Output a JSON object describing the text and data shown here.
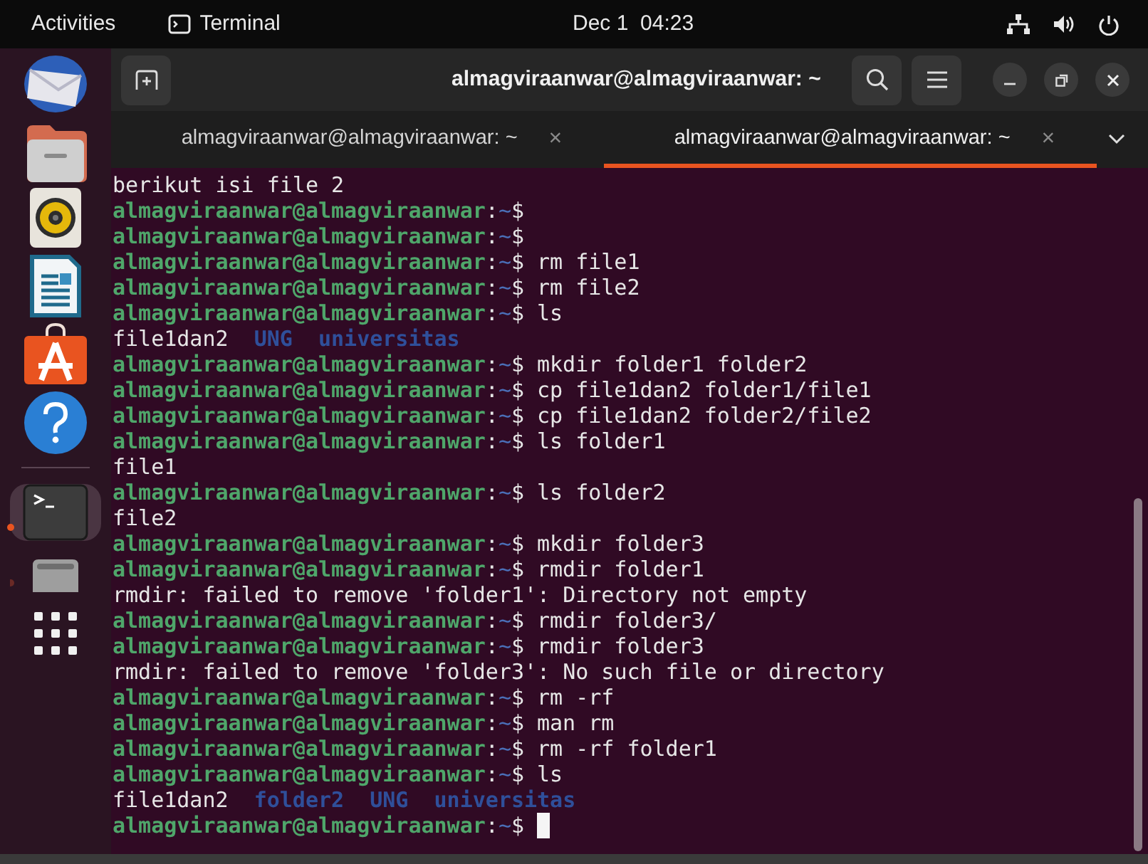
{
  "top_bar": {
    "activities": "Activities",
    "app_name": "Terminal",
    "clock": "Dec 1  04:23"
  },
  "dock": {
    "items": [
      {
        "kind": "mail",
        "running": false,
        "selected": false
      },
      {
        "kind": "files",
        "running": false,
        "selected": false
      },
      {
        "kind": "music",
        "running": false,
        "selected": false
      },
      {
        "kind": "writer",
        "running": false,
        "selected": false
      },
      {
        "kind": "store",
        "running": false,
        "selected": false
      },
      {
        "kind": "help",
        "running": false,
        "selected": false
      },
      {
        "kind": "terminal",
        "running": true,
        "selected": true
      },
      {
        "kind": "drive",
        "running": true,
        "selected": false
      }
    ]
  },
  "window": {
    "title": "almagviraanwar@almagviraanwar: ~"
  },
  "tabs": [
    {
      "label": "almagviraanwar@almagviraanwar: ~",
      "close": "×",
      "selected": false
    },
    {
      "label": "almagviraanwar@almagviraanwar: ~",
      "close": "×",
      "selected": true
    }
  ],
  "terminal": {
    "lines": [
      {
        "kind": "output",
        "text": "berikut isi file 2"
      },
      {
        "kind": "prompt",
        "user": "almagviraanwar@almagviraanwar",
        "colon": ":",
        "path": "~",
        "symbol": "$"
      },
      {
        "kind": "prompt",
        "user": "almagviraanwar@almagviraanwar",
        "colon": ":",
        "path": "~",
        "symbol": "$"
      },
      {
        "kind": "prompt",
        "user": "almagviraanwar@almagviraanwar",
        "colon": ":",
        "path": "~",
        "symbol": "$",
        "command": "rm file1"
      },
      {
        "kind": "prompt",
        "user": "almagviraanwar@almagviraanwar",
        "colon": ":",
        "path": "~",
        "symbol": "$",
        "command": "rm file2"
      },
      {
        "kind": "prompt",
        "user": "almagviraanwar@almagviraanwar",
        "colon": ":",
        "path": "~",
        "symbol": "$",
        "command": "ls"
      },
      {
        "kind": "listing",
        "entries": [
          {
            "text": "file1dan2",
            "kind": "file"
          },
          {
            "text": "UNG",
            "kind": "dir"
          },
          {
            "text": "universitas",
            "kind": "dir"
          }
        ]
      },
      {
        "kind": "prompt",
        "user": "almagviraanwar@almagviraanwar",
        "colon": ":",
        "path": "~",
        "symbol": "$",
        "command": "mkdir folder1 folder2"
      },
      {
        "kind": "prompt",
        "user": "almagviraanwar@almagviraanwar",
        "colon": ":",
        "path": "~",
        "symbol": "$",
        "command": "cp file1dan2 folder1/file1"
      },
      {
        "kind": "prompt",
        "user": "almagviraanwar@almagviraanwar",
        "colon": ":",
        "path": "~",
        "symbol": "$",
        "command": "cp file1dan2 folder2/file2"
      },
      {
        "kind": "prompt",
        "user": "almagviraanwar@almagviraanwar",
        "colon": ":",
        "path": "~",
        "symbol": "$",
        "command": "ls folder1"
      },
      {
        "kind": "output",
        "text": "file1"
      },
      {
        "kind": "prompt",
        "user": "almagviraanwar@almagviraanwar",
        "colon": ":",
        "path": "~",
        "symbol": "$",
        "command": "ls folder2"
      },
      {
        "kind": "output",
        "text": "file2"
      },
      {
        "kind": "prompt",
        "user": "almagviraanwar@almagviraanwar",
        "colon": ":",
        "path": "~",
        "symbol": "$",
        "command": "mkdir folder3"
      },
      {
        "kind": "prompt",
        "user": "almagviraanwar@almagviraanwar",
        "colon": ":",
        "path": "~",
        "symbol": "$",
        "command": "rmdir folder1"
      },
      {
        "kind": "output",
        "text": "rmdir: failed to remove 'folder1': Directory not empty"
      },
      {
        "kind": "prompt",
        "user": "almagviraanwar@almagviraanwar",
        "colon": ":",
        "path": "~",
        "symbol": "$",
        "command": "rmdir folder3/"
      },
      {
        "kind": "prompt",
        "user": "almagviraanwar@almagviraanwar",
        "colon": ":",
        "path": "~",
        "symbol": "$",
        "command": "rmdir folder3"
      },
      {
        "kind": "output",
        "text": "rmdir: failed to remove 'folder3': No such file or directory"
      },
      {
        "kind": "prompt",
        "user": "almagviraanwar@almagviraanwar",
        "colon": ":",
        "path": "~",
        "symbol": "$",
        "command": "rm -rf"
      },
      {
        "kind": "prompt",
        "user": "almagviraanwar@almagviraanwar",
        "colon": ":",
        "path": "~",
        "symbol": "$",
        "command": "man rm"
      },
      {
        "kind": "prompt",
        "user": "almagviraanwar@almagviraanwar",
        "colon": ":",
        "path": "~",
        "symbol": "$",
        "command": "rm -rf folder1"
      },
      {
        "kind": "prompt",
        "user": "almagviraanwar@almagviraanwar",
        "colon": ":",
        "path": "~",
        "symbol": "$",
        "command": "ls"
      },
      {
        "kind": "listing",
        "entries": [
          {
            "text": "file1dan2",
            "kind": "file"
          },
          {
            "text": "folder2",
            "kind": "dir"
          },
          {
            "text": "UNG",
            "kind": "dir"
          },
          {
            "text": "universitas",
            "kind": "dir"
          }
        ]
      },
      {
        "kind": "prompt",
        "user": "almagviraanwar@almagviraanwar",
        "colon": ":",
        "path": "~",
        "symbol": "$",
        "cursor": true
      }
    ]
  }
}
